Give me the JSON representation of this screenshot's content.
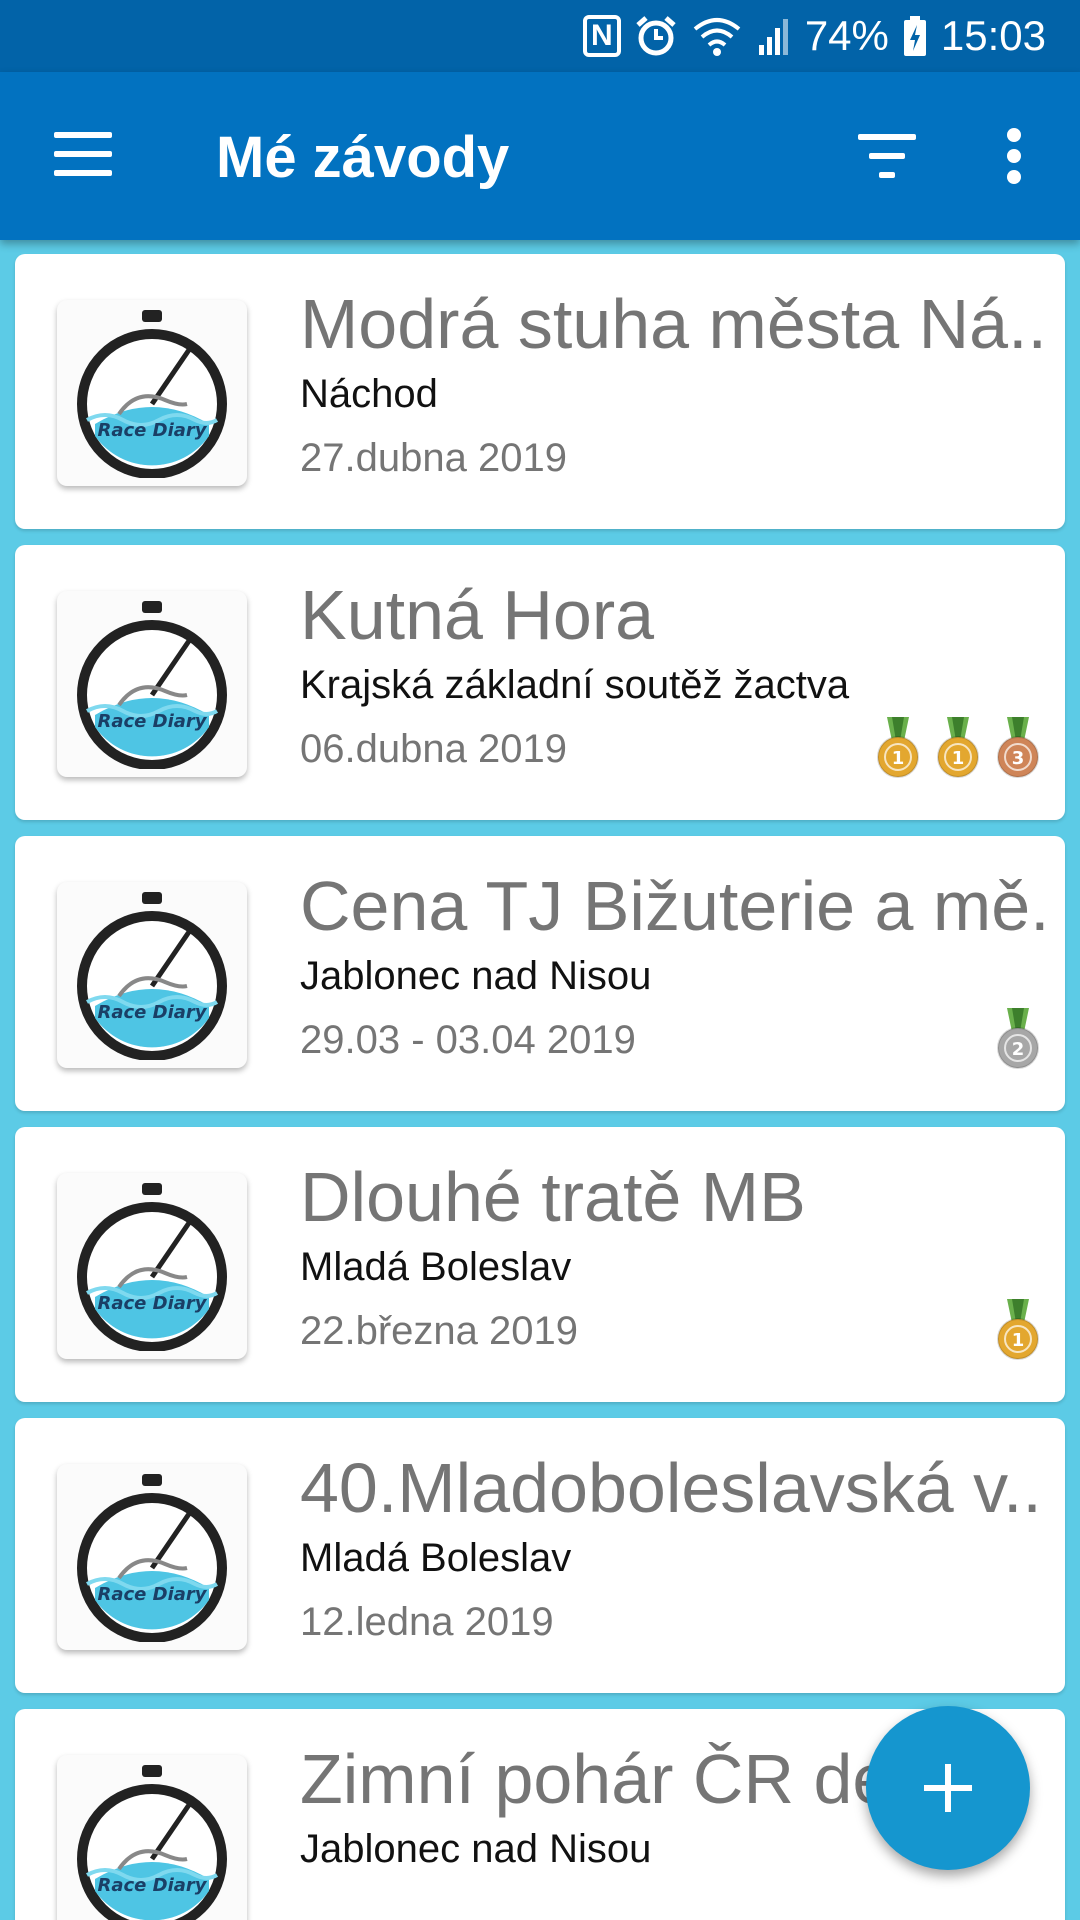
{
  "status_bar": {
    "nfc_icon": "N",
    "battery_percent": "74%",
    "time": "15:03"
  },
  "app_bar": {
    "title": "Mé závody"
  },
  "races": [
    {
      "name": "Modrá stuha města Ná..",
      "location": "Náchod",
      "date": "27.dubna 2019",
      "medals": []
    },
    {
      "name": "Kutná Hora",
      "location": "Krajská základní soutěž žactva",
      "date": "06.dubna 2019",
      "medals": [
        "1",
        "1",
        "3"
      ]
    },
    {
      "name": "Cena TJ Bižuterie a mě..",
      "location": "Jablonec nad Nisou",
      "date": "29.03 - 03.04 2019",
      "medals": [
        "2"
      ]
    },
    {
      "name": "Dlouhé tratě MB",
      "location": "Mladá Boleslav",
      "date": "22.března 2019",
      "medals": [
        "1"
      ]
    },
    {
      "name": "40.Mladoboleslavská v..",
      "location": "Mladá Boleslav",
      "date": "12.ledna 2019",
      "medals": []
    },
    {
      "name": "Zimní pohár ČR de",
      "location": "Jablonec nad Nisou",
      "date": "",
      "medals": []
    }
  ],
  "logo_text": "Race Diary",
  "colors": {
    "status_bar": "#0263a8",
    "app_bar": "#0272c0",
    "list_background": "#5ccbe6",
    "fab": "#1596cf",
    "gold": "#e3a72f",
    "silver": "#a7a7a7",
    "bronze": "#cf8558",
    "ribbon": "#6ab04c"
  },
  "icons": {
    "menu": "hamburger-menu-icon",
    "filter": "filter-icon",
    "more": "more-vert-icon",
    "fab": "plus-icon",
    "medal": "medal-icon"
  }
}
